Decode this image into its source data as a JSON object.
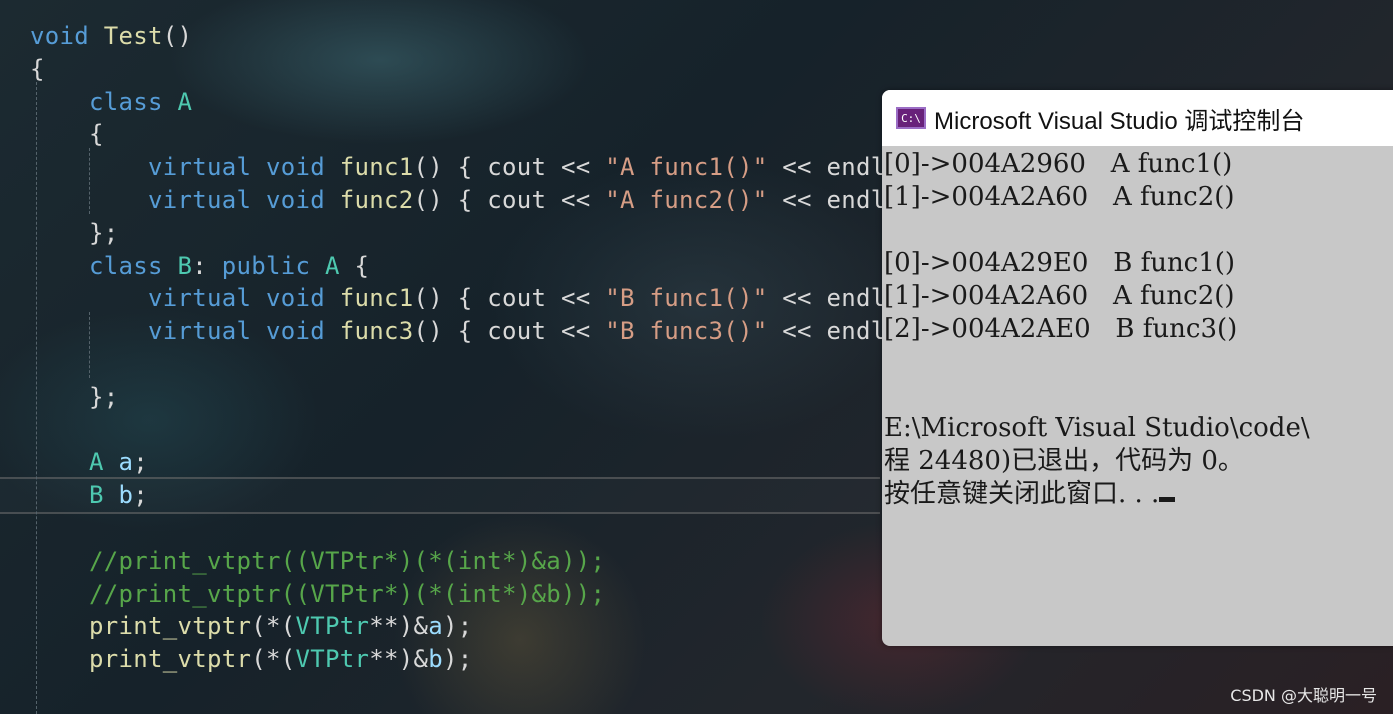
{
  "editor": {
    "lines": [
      [
        {
          "t": "void",
          "c": "kw"
        },
        {
          "t": " ",
          "c": "pl"
        },
        {
          "t": "Test",
          "c": "fn"
        },
        {
          "t": "()",
          "c": "pl"
        }
      ],
      [
        {
          "t": "{",
          "c": "pl"
        }
      ],
      [
        {
          "t": "    ",
          "c": "pl"
        },
        {
          "t": "class",
          "c": "kw"
        },
        {
          "t": " ",
          "c": "pl"
        },
        {
          "t": "A",
          "c": "ty"
        }
      ],
      [
        {
          "t": "    {",
          "c": "pl"
        }
      ],
      [
        {
          "t": "        ",
          "c": "pl"
        },
        {
          "t": "virtual",
          "c": "kw"
        },
        {
          "t": " ",
          "c": "pl"
        },
        {
          "t": "void",
          "c": "kw"
        },
        {
          "t": " ",
          "c": "pl"
        },
        {
          "t": "func1",
          "c": "fn"
        },
        {
          "t": "() { cout << ",
          "c": "pl"
        },
        {
          "t": "\"A func1()\"",
          "c": "str"
        },
        {
          "t": " << endl; }",
          "c": "pl"
        }
      ],
      [
        {
          "t": "        ",
          "c": "pl"
        },
        {
          "t": "virtual",
          "c": "kw"
        },
        {
          "t": " ",
          "c": "pl"
        },
        {
          "t": "void",
          "c": "kw"
        },
        {
          "t": " ",
          "c": "pl"
        },
        {
          "t": "func2",
          "c": "fn"
        },
        {
          "t": "() { cout << ",
          "c": "pl"
        },
        {
          "t": "\"A func2()\"",
          "c": "str"
        },
        {
          "t": " << endl; }",
          "c": "pl"
        }
      ],
      [
        {
          "t": "    };",
          "c": "pl"
        }
      ],
      [
        {
          "t": "    ",
          "c": "pl"
        },
        {
          "t": "class",
          "c": "kw"
        },
        {
          "t": " ",
          "c": "pl"
        },
        {
          "t": "B",
          "c": "ty"
        },
        {
          "t": ": ",
          "c": "pl"
        },
        {
          "t": "public",
          "c": "kw"
        },
        {
          "t": " ",
          "c": "pl"
        },
        {
          "t": "A",
          "c": "ty"
        },
        {
          "t": " {",
          "c": "pl"
        }
      ],
      [
        {
          "t": "        ",
          "c": "pl"
        },
        {
          "t": "virtual",
          "c": "kw"
        },
        {
          "t": " ",
          "c": "pl"
        },
        {
          "t": "void",
          "c": "kw"
        },
        {
          "t": " ",
          "c": "pl"
        },
        {
          "t": "func1",
          "c": "fn"
        },
        {
          "t": "() { cout << ",
          "c": "pl"
        },
        {
          "t": "\"B func1()\"",
          "c": "str"
        },
        {
          "t": " << endl; }",
          "c": "pl"
        }
      ],
      [
        {
          "t": "        ",
          "c": "pl"
        },
        {
          "t": "virtual",
          "c": "kw"
        },
        {
          "t": " ",
          "c": "pl"
        },
        {
          "t": "void",
          "c": "kw"
        },
        {
          "t": " ",
          "c": "pl"
        },
        {
          "t": "func3",
          "c": "fn"
        },
        {
          "t": "() { cout << ",
          "c": "pl"
        },
        {
          "t": "\"B func3()\"",
          "c": "str"
        },
        {
          "t": " << endl; }",
          "c": "pl"
        }
      ],
      [
        {
          "t": "",
          "c": "pl"
        }
      ],
      [
        {
          "t": "    };",
          "c": "pl"
        }
      ],
      [
        {
          "t": "",
          "c": "pl"
        }
      ],
      [
        {
          "t": "    ",
          "c": "pl"
        },
        {
          "t": "A",
          "c": "ty"
        },
        {
          "t": " ",
          "c": "pl"
        },
        {
          "t": "a",
          "c": "vr"
        },
        {
          "t": ";",
          "c": "pl"
        }
      ],
      [
        {
          "t": "    ",
          "c": "pl"
        },
        {
          "t": "B",
          "c": "ty"
        },
        {
          "t": " ",
          "c": "pl"
        },
        {
          "t": "b",
          "c": "vr"
        },
        {
          "t": ";",
          "c": "pl"
        }
      ],
      [
        {
          "t": "",
          "c": "pl"
        }
      ],
      [
        {
          "t": "    //print_vtptr((VTPtr*)(*(int*)&a));",
          "c": "cm"
        }
      ],
      [
        {
          "t": "    //print_vtptr((VTPtr*)(*(int*)&b));",
          "c": "cm"
        }
      ],
      [
        {
          "t": "    ",
          "c": "pl"
        },
        {
          "t": "print_vtptr",
          "c": "fn"
        },
        {
          "t": "(*(",
          "c": "pl"
        },
        {
          "t": "VTPtr",
          "c": "ty"
        },
        {
          "t": "**)&",
          "c": "pl"
        },
        {
          "t": "a",
          "c": "vr"
        },
        {
          "t": ");",
          "c": "pl"
        }
      ],
      [
        {
          "t": "    ",
          "c": "pl"
        },
        {
          "t": "print_vtptr",
          "c": "fn"
        },
        {
          "t": "(*(",
          "c": "pl"
        },
        {
          "t": "VTPtr",
          "c": "ty"
        },
        {
          "t": "**)&",
          "c": "pl"
        },
        {
          "t": "b",
          "c": "vr"
        },
        {
          "t": ");",
          "c": "pl"
        }
      ]
    ]
  },
  "console": {
    "icon_text": "C:\\",
    "title": "Microsoft Visual Studio 调试控制台",
    "lines": [
      "[0]->004A2960   A func1()",
      "[1]->004A2A60   A func2()",
      "",
      "[0]->004A29E0   B func1()",
      "[1]->004A2A60   A func2()",
      "[2]->004A2AE0   B func3()",
      "",
      "",
      "E:\\Microsoft Visual Studio\\code\\",
      "程 24480)已退出，代码为 0。",
      "按任意键关闭此窗口. . ."
    ]
  },
  "watermark": "CSDN @大聪明一号"
}
